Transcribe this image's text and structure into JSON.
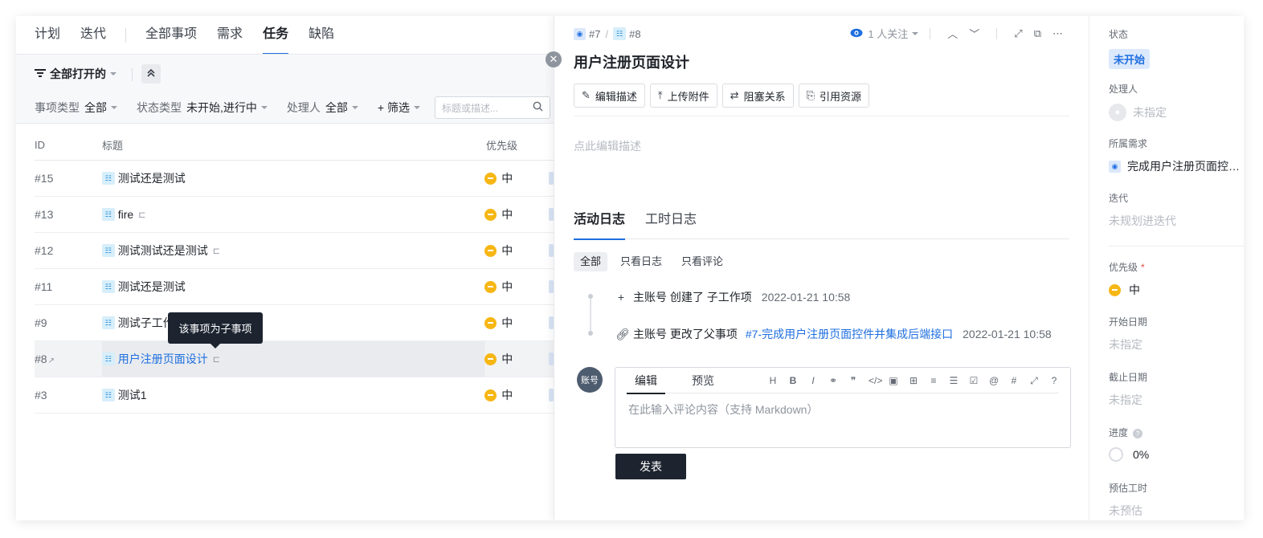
{
  "top_nav": {
    "tabs": [
      "计划",
      "迭代",
      "全部事项",
      "需求",
      "任务",
      "缺陷"
    ],
    "active_index": 4
  },
  "view": {
    "label": "全部打开的"
  },
  "filters": {
    "item_type_label": "事项类型",
    "item_type_value": "全部",
    "status_type_label": "状态类型",
    "status_type_value": "未开始,进行中",
    "assignee_label": "处理人",
    "assignee_value": "全部",
    "filter_btn": "+ 筛选",
    "search_placeholder": "标题或描述..."
  },
  "table": {
    "headers": {
      "id": "ID",
      "title": "标题",
      "priority": "优先级"
    },
    "rows": [
      {
        "id": "#15",
        "title": "测试还是测试",
        "priority": "中",
        "subtask": false
      },
      {
        "id": "#13",
        "title": "fire",
        "priority": "中",
        "subtask": true
      },
      {
        "id": "#12",
        "title": "测试测试还是测试",
        "priority": "中",
        "subtask": true
      },
      {
        "id": "#11",
        "title": "测试还是测试",
        "priority": "中",
        "subtask": false
      },
      {
        "id": "#9",
        "title": "测试子工作",
        "priority": "中",
        "subtask": false
      },
      {
        "id": "#8",
        "title": "用户注册页面设计",
        "priority": "中",
        "subtask": true,
        "selected": true
      },
      {
        "id": "#3",
        "title": "测试1",
        "priority": "中",
        "subtask": false
      }
    ]
  },
  "tooltip": "该事项为子事项",
  "detail": {
    "crumb_parent": "#7",
    "crumb_self": "#8",
    "watchers": "1 人关注",
    "title": "用户注册页面设计",
    "actions": [
      "编辑描述",
      "上传附件",
      "阻塞关系",
      "引用资源"
    ],
    "desc_placeholder": "点此编辑描述",
    "log_tabs": [
      "活动日志",
      "工时日志"
    ],
    "log_filters": [
      "全部",
      "只看日志",
      "只看评论"
    ],
    "logs": [
      {
        "icon": "plus-icon",
        "text": "主账号 创建了 子工作项",
        "link": "",
        "time": "2022-01-21 10:58"
      },
      {
        "icon": "link-icon",
        "text": "主账号 更改了父事项",
        "link": "#7-完成用户注册页面控件并集成后端接口",
        "time": "2022-01-21 10:58"
      }
    ],
    "avatar_text": "账号",
    "editor_tabs": [
      "编辑",
      "预览"
    ],
    "editor_placeholder": "在此输入评论内容（支持 Markdown）",
    "submit": "发表"
  },
  "props": {
    "status_label": "状态",
    "status_value": "未开始",
    "assignee_label": "处理人",
    "assignee_value": "未指定",
    "requirement_label": "所属需求",
    "requirement_value": "完成用户注册页面控件并集成后端接口",
    "iteration_label": "迭代",
    "iteration_value": "未规划进迭代",
    "priority_label": "优先级",
    "priority_value": "中",
    "start_label": "开始日期",
    "start_value": "未指定",
    "due_label": "截止日期",
    "due_value": "未指定",
    "progress_label": "进度",
    "progress_value": "0%",
    "estimate_label": "预估工时",
    "estimate_value": "未预估"
  },
  "colors": {
    "accent": "#1f6fe0",
    "priority_mid": "#f6b614",
    "dark_button": "#1d2430"
  }
}
